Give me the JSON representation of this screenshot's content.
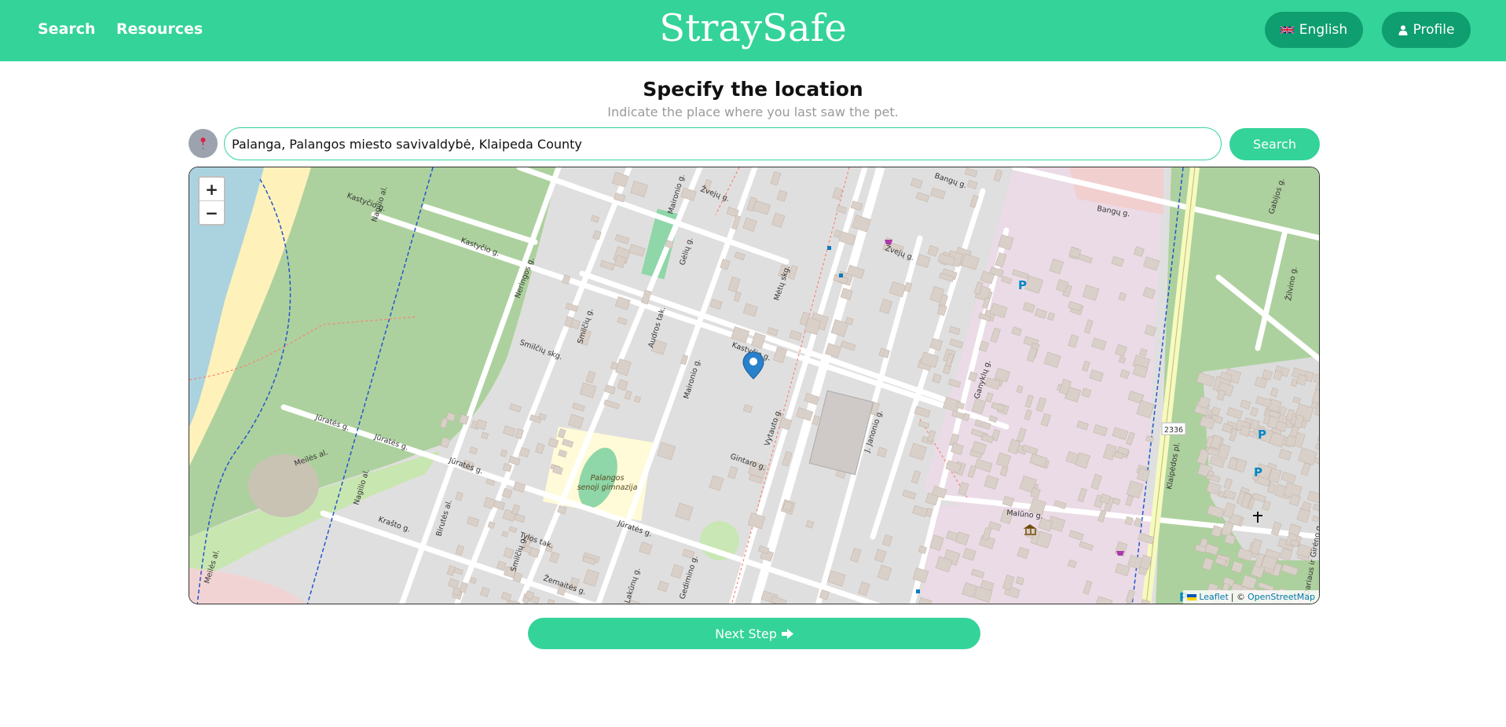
{
  "nav": {
    "links": [
      "Search",
      "Resources"
    ],
    "brand": "StraySafe",
    "language_label": "English",
    "profile_label": "Profile"
  },
  "header": {
    "title": "Specify the location",
    "subtitle": "Indicate the place where you last saw the pet."
  },
  "search": {
    "value": "Palanga, Palangos miesto savivaldybė, Klaipeda County",
    "button_label": "Search"
  },
  "map": {
    "zoom_in": "+",
    "zoom_out": "−",
    "attribution": {
      "leaflet": "Leaflet",
      "separator": "| ©",
      "osm": "OpenStreetMap"
    },
    "labels": {
      "streets": [
        "Kastyčio g.",
        "Kastyčio g.",
        "Kastyčio g.",
        "Jūratės g.",
        "Jūratės g.",
        "Jūratės g.",
        "Jūratės g.",
        "Gintaro g.",
        "Maironio g.",
        "Maironio g.",
        "Vytauto g.",
        "J. Janonio g.",
        "Ganyklų g.",
        "Malūno g.",
        "Bangų g.",
        "Bangų g.",
        "Žvejų g.",
        "Žvejų g.",
        "Nagilio al.",
        "Nagilio al.",
        "Neringos g.",
        "Smilčių g.",
        "Smilčių g.",
        "Smilčių skg.",
        "Gėlių g.",
        "Audros tak.",
        "Mėtų skg.",
        "Meilės al.",
        "Meilės al.",
        "Kraštо g.",
        "Birutės al.",
        "Tylos tak.",
        "Žemaitės g.",
        "Klaipėdos pl.",
        "Gabijos g.",
        "Žilvino g.",
        "Dariaus ir Girėno g.",
        "Lakūnų g.",
        "Gedimino g."
      ],
      "gymnasium": [
        "Palangos",
        "senoji gimnazija"
      ],
      "road_number": "2336"
    },
    "colors": {
      "land": "#e0dfdf",
      "water": "#aad3df",
      "beach": "#fff1ba",
      "park": "#add19e",
      "school": "#fffbd8",
      "commercial": "#f2dbe6",
      "building": "#d9d0c9",
      "marker": "#2a81cb"
    }
  },
  "footer": {
    "next_label": "Next Step"
  }
}
